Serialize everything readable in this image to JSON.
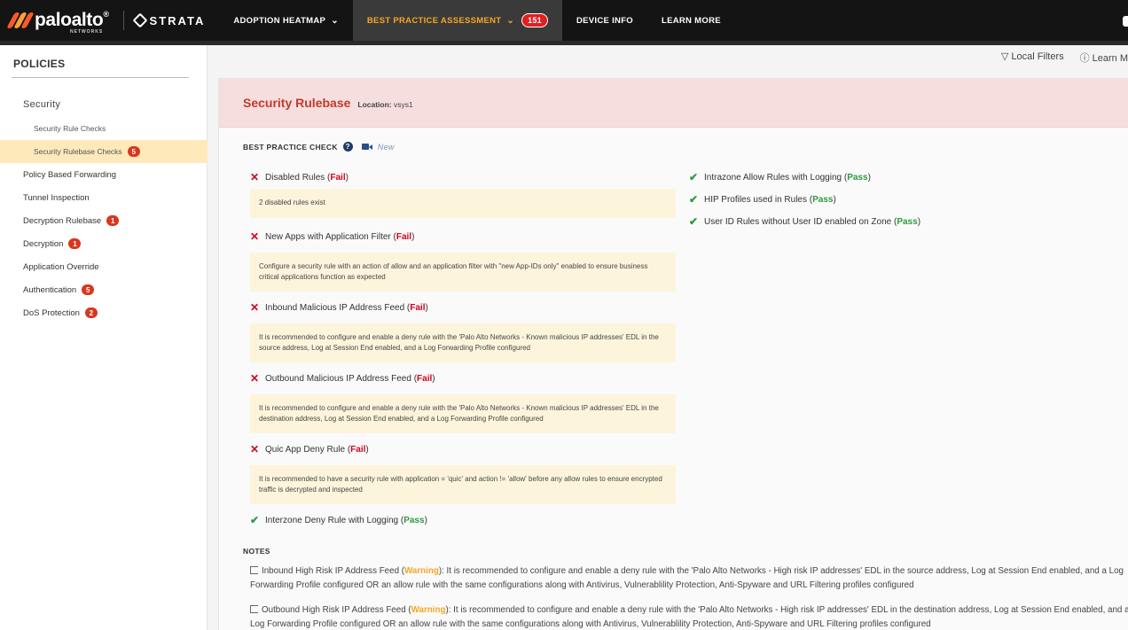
{
  "brand": {
    "name": "paloalto",
    "registered": "®",
    "sub": "NETWORKS",
    "product": "STRATA",
    "logo_colors": [
      "#fa582d",
      "#f7a23a",
      "#fa582d"
    ]
  },
  "nav": {
    "items": [
      {
        "label": "ADOPTION HEATMAP",
        "chevron": "⌄"
      },
      {
        "label": "BEST PRACTICE ASSESSMENT",
        "chevron": "⌄",
        "badge": "151"
      },
      {
        "label": "DEVICE INFO"
      },
      {
        "label": "LEARN MORE"
      }
    ]
  },
  "sidebar": {
    "title": "POLICIES",
    "section": "Security",
    "sub_items": [
      {
        "label": "Security Rule Checks"
      },
      {
        "label": "Security Rulebase Checks",
        "badge": "5"
      }
    ],
    "items": [
      {
        "label": "Policy Based Forwarding"
      },
      {
        "label": "Tunnel Inspection"
      },
      {
        "label": "Decryption Rulebase",
        "badge": "1"
      },
      {
        "label": "Decryption",
        "badge": "1"
      },
      {
        "label": "Application Override"
      },
      {
        "label": "Authentication",
        "badge": "5"
      },
      {
        "label": "DoS Protection",
        "badge": "2"
      }
    ]
  },
  "toolbar": {
    "local_filters": "Local Filters",
    "learn_more": "Learn M"
  },
  "panel": {
    "title": "Security Rulebase",
    "location_label": "Location:",
    "location_value": "vsys1",
    "bpc_label": "BEST PRACTICE CHECK",
    "new_label": "New",
    "left_checks": [
      {
        "name": "Disabled Rules",
        "status": "Fail",
        "desc": "2 disabled rules exist"
      },
      {
        "name": "New Apps with Application Filter",
        "status": "Fail",
        "desc": "Configure a security rule with an action of allow and an application filter with \"new App-IDs only\" enabled to ensure business critical applications function as expected"
      },
      {
        "name": "Inbound Malicious IP Address Feed",
        "status": "Fail",
        "desc": "It is recommended to configure and enable a deny rule with the 'Palo Alto Networks - Known malicious IP addresses' EDL in the source address, Log at Session End enabled, and a Log Forwarding Profile configured"
      },
      {
        "name": "Outbound Malicious IP Address Feed",
        "status": "Fail",
        "desc": "It is recommended to configure and enable a deny rule with the 'Palo Alto Networks - Known malicious IP addresses' EDL in the destination address, Log at Session End enabled, and a Log Forwarding Profile configured"
      },
      {
        "name": "Quic App Deny Rule",
        "status": "Fail",
        "desc": "It is recommended to have a security rule with application = 'quic' and action != 'allow' before any allow rules to ensure encrypted traffic is decrypted and inspected"
      },
      {
        "name": "Interzone Deny Rule with Logging",
        "status": "Pass"
      }
    ],
    "right_checks": [
      {
        "name": "Intrazone Allow Rules with Logging",
        "status": "Pass"
      },
      {
        "name": "HIP Profiles used in Rules",
        "status": "Pass"
      },
      {
        "name": "User ID Rules without User ID enabled on Zone",
        "status": "Pass"
      }
    ],
    "notes_label": "NOTES",
    "notes": [
      {
        "name": "Inbound High Risk IP Address Feed",
        "status": "Warning",
        "text": ": It is recommended to configure and enable a deny rule with the 'Palo Alto Networks - High risk IP addresses' EDL in the source address, Log at Session End enabled, and a Log Forwarding Profile configured OR an allow rule with the same configurations along with Antivirus, Vulnerablility Protection, Anti-Spyware and URL Filtering profiles configured"
      },
      {
        "name": "Outbound High Risk IP Address Feed",
        "status": "Warning",
        "text": ": It is recommended to configure and enable a deny rule with the 'Palo Alto Networks - High risk IP addresses' EDL in the destination address, Log at Session End enabled, and a Log Forwarding Profile configured OR an allow rule with the same configurations along with Antivirus, Vulnerablility Protection, Anti-Spyware and URL Filtering profiles configured"
      }
    ]
  },
  "colors": {
    "fail": "#d0021b",
    "pass": "#2e9940",
    "warning": "#f5a623",
    "header_bg": "#f7dede",
    "active_nav": "#f6a623"
  }
}
